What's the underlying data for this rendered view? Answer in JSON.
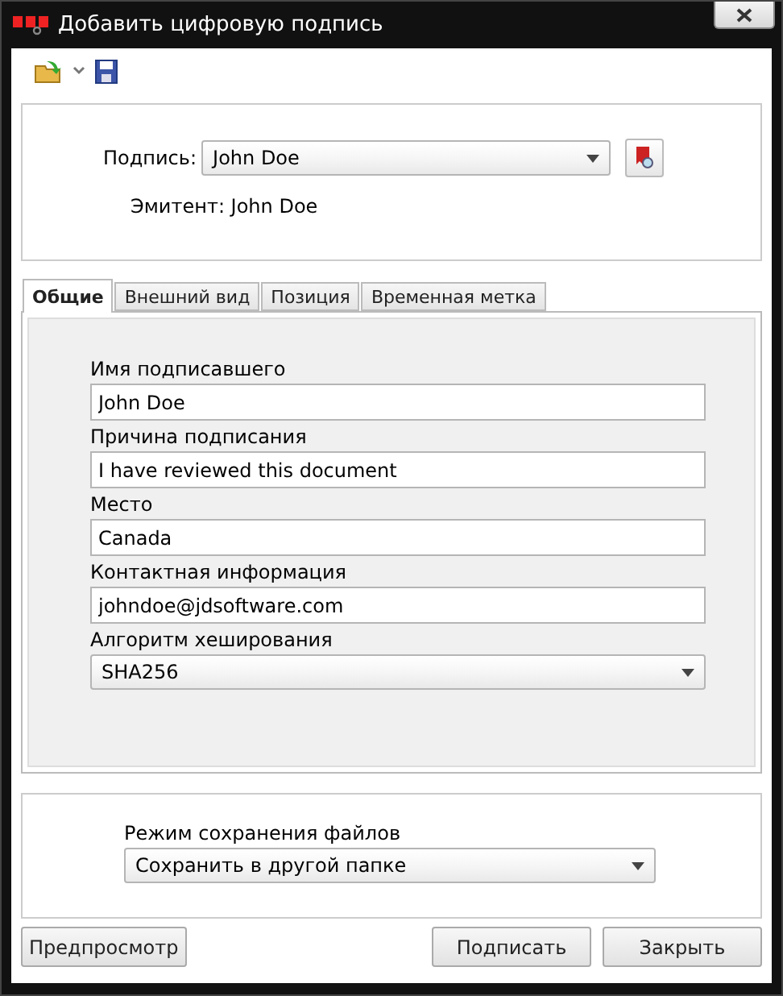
{
  "window": {
    "title": "Добавить цифровую подпись"
  },
  "signature": {
    "label": "Подпись:",
    "value": "John Doe",
    "issuer": "Эмитент: John Doe"
  },
  "tabs": [
    {
      "label": "Общие",
      "selected": true
    },
    {
      "label": "Внешний вид",
      "selected": false
    },
    {
      "label": "Позиция",
      "selected": false
    },
    {
      "label": "Временная метка",
      "selected": false
    }
  ],
  "fields": [
    {
      "kind": "text",
      "label": "Имя подписавшего",
      "value": "John Doe"
    },
    {
      "kind": "text",
      "label": "Причина подписания",
      "value": "I have reviewed this document"
    },
    {
      "kind": "text",
      "label": "Место",
      "value": "Canada"
    },
    {
      "kind": "text",
      "label": "Контактная информация",
      "value": "johndoe@jdsoftware.com"
    },
    {
      "kind": "select",
      "label": "Алгоритм хеширования",
      "value": "SHA256"
    }
  ],
  "save_mode": {
    "label": "Режим сохранения файлов",
    "value": "Сохранить в другой папке"
  },
  "buttons": {
    "left": [
      "Предпросмотр"
    ],
    "right": [
      "Подписать",
      "Закрыть"
    ]
  }
}
